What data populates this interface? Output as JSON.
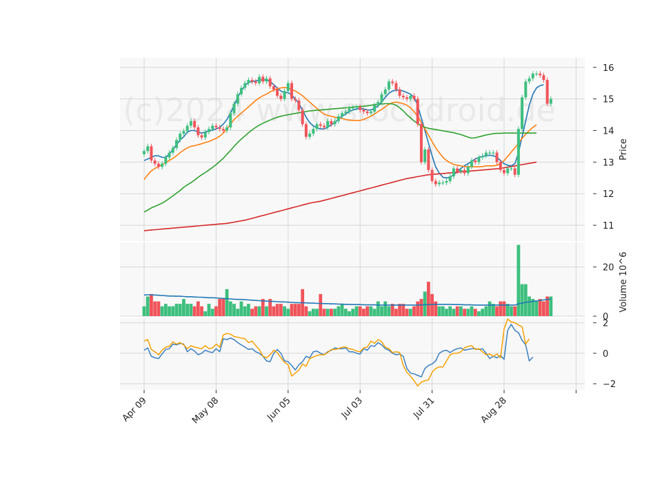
{
  "chart_data": {
    "type": "candlestick",
    "watermark": "(c)2024 www.stockdroid.de",
    "colors": {
      "up": "#3dbf7e",
      "down": "#f0545a",
      "panel_bg": "#f8f8f8",
      "grid": "#d6d6d6",
      "ma_short": "#1f77b4",
      "ma_mid": "#ff7f0e",
      "ma_long": "#2ca02c",
      "ma_longest": "#d62728",
      "volume_avg": "#1f77b4",
      "osc_1": "#3a7fbf",
      "osc_2": "#f5a000"
    },
    "x_axis": {
      "tick_labels": [
        "Apr 09",
        "May 08",
        "Jun 05",
        "Jul 03",
        "Jul 31",
        "Aug 28"
      ],
      "tick_index": [
        0,
        20,
        40,
        60,
        80,
        100
      ]
    },
    "price_panel": {
      "ylabel": "Price",
      "ylim": [
        10.5,
        16.3
      ],
      "ticks": [
        11,
        12,
        13,
        14,
        15,
        16
      ],
      "close": [
        13.35,
        13.5,
        13.05,
        12.95,
        12.85,
        12.95,
        13.15,
        13.3,
        13.45,
        13.7,
        13.9,
        13.98,
        14.15,
        14.3,
        14.1,
        13.85,
        13.78,
        13.95,
        14.05,
        14.15,
        14.1,
        14.05,
        14.0,
        14.1,
        14.55,
        14.85,
        15.15,
        15.35,
        15.5,
        15.6,
        15.55,
        15.5,
        15.7,
        15.55,
        15.65,
        15.4,
        15.3,
        15.1,
        15.0,
        15.25,
        15.5,
        15.0,
        14.95,
        14.65,
        14.2,
        13.8,
        13.9,
        14.05,
        14.2,
        14.15,
        14.1,
        14.3,
        14.2,
        14.3,
        14.45,
        14.55,
        14.6,
        14.7,
        14.72,
        14.75,
        14.65,
        14.6,
        14.55,
        14.6,
        14.8,
        14.9,
        15.15,
        15.3,
        15.55,
        15.5,
        15.3,
        15.1,
        15.05,
        15.0,
        15.1,
        15.0,
        14.2,
        13.0,
        13.4,
        12.75,
        12.4,
        12.3,
        12.35,
        12.35,
        12.4,
        12.55,
        12.8,
        12.7,
        12.75,
        12.65,
        12.85,
        13.05,
        13.0,
        13.15,
        13.2,
        13.3,
        13.3,
        13.3,
        13.0,
        12.75,
        12.65,
        12.8,
        12.8,
        12.6,
        14.05,
        15.05,
        15.55,
        15.65,
        15.8,
        15.8,
        15.75,
        15.6,
        14.85,
        15.0
      ],
      "series": [
        {
          "name": "",
          "values": [
            13.05,
            13.1,
            13.15,
            13.2,
            13.2,
            13.15,
            13.15,
            13.25,
            13.4,
            13.55,
            13.7,
            13.8,
            13.95,
            14.0,
            14.0,
            13.95,
            13.92,
            13.95,
            13.98,
            14.02,
            14.05,
            14.1,
            14.2,
            14.35,
            14.55,
            14.8,
            15.05,
            15.25,
            15.42,
            15.52,
            15.55,
            15.57,
            15.6,
            15.6,
            15.6,
            15.55,
            15.45,
            15.35,
            15.25,
            15.2,
            15.2,
            15.12,
            15.0,
            14.85,
            14.65,
            14.42,
            14.25,
            14.15,
            14.08,
            14.05,
            14.05,
            14.1,
            14.18,
            14.25,
            14.35,
            14.45,
            14.52,
            14.6,
            14.65,
            14.68,
            14.7,
            14.68,
            14.65,
            14.65,
            14.7,
            14.78,
            14.9,
            15.05,
            15.18,
            15.25,
            15.28,
            15.28,
            15.25,
            15.2,
            15.15,
            15.05,
            14.8,
            14.4,
            14.0,
            13.6,
            13.2,
            12.85,
            12.65,
            12.52,
            12.5,
            12.52,
            12.6,
            12.7,
            12.8,
            12.88,
            12.95,
            13.02,
            13.1,
            13.15,
            13.18,
            13.2,
            13.22,
            13.2,
            13.15,
            13.05,
            12.95,
            12.9,
            12.88,
            12.95,
            13.3,
            13.8,
            14.3,
            14.8,
            15.15,
            15.35,
            15.42,
            15.45
          ]
        },
        {
          "name": "",
          "values": [
            12.45,
            12.6,
            12.72,
            12.8,
            12.86,
            12.92,
            12.98,
            13.05,
            13.12,
            13.2,
            13.3,
            13.38,
            13.45,
            13.5,
            13.52,
            13.55,
            13.58,
            13.62,
            13.65,
            13.7,
            13.75,
            13.82,
            13.92,
            14.05,
            14.2,
            14.35,
            14.45,
            14.55,
            14.65,
            14.75,
            14.85,
            14.95,
            15.03,
            15.1,
            15.15,
            15.22,
            15.28,
            15.32,
            15.35,
            15.36,
            15.35,
            15.3,
            15.25,
            15.18,
            15.1,
            15.0,
            14.9,
            14.8,
            14.7,
            14.6,
            14.52,
            14.48,
            14.45,
            14.42,
            14.4,
            14.38,
            14.35,
            14.33,
            14.32,
            14.32,
            14.32,
            14.35,
            14.4,
            14.45,
            14.52,
            14.6,
            14.67,
            14.75,
            14.83,
            14.88,
            14.9,
            14.88,
            14.85,
            14.8,
            14.72,
            14.6,
            14.45,
            14.25,
            14.05,
            13.85,
            13.65,
            13.45,
            13.3,
            13.15,
            13.05,
            12.98,
            12.93,
            12.9,
            12.88,
            12.86,
            12.85,
            12.85,
            12.85,
            12.85,
            12.86,
            12.88,
            12.88,
            12.88,
            12.9,
            12.95,
            13.05,
            13.18,
            13.32,
            13.45,
            13.6,
            13.75,
            13.88,
            14.0,
            14.1,
            14.18
          ]
        },
        {
          "name": "",
          "values": [
            11.42,
            11.48,
            11.55,
            11.6,
            11.65,
            11.7,
            11.77,
            11.85,
            11.93,
            12.02,
            12.1,
            12.2,
            12.28,
            12.35,
            12.43,
            12.52,
            12.6,
            12.67,
            12.75,
            12.83,
            12.92,
            13.02,
            13.12,
            13.25,
            13.37,
            13.5,
            13.62,
            13.73,
            13.83,
            13.93,
            14.02,
            14.1,
            14.17,
            14.23,
            14.28,
            14.33,
            14.38,
            14.42,
            14.45,
            14.48,
            14.5,
            14.52,
            14.54,
            14.56,
            14.58,
            14.6,
            14.62,
            14.63,
            14.64,
            14.65,
            14.66,
            14.67,
            14.68,
            14.69,
            14.7,
            14.71,
            14.72,
            14.73,
            14.74,
            14.75,
            14.76,
            14.77,
            14.78,
            14.8,
            14.82,
            14.83,
            14.84,
            14.85,
            14.85,
            14.84,
            14.8,
            14.72,
            14.62,
            14.5,
            14.4,
            14.3,
            14.22,
            14.15,
            14.1,
            14.07,
            14.05,
            14.03,
            14.01,
            13.99,
            13.97,
            13.95,
            13.93,
            13.9,
            13.87,
            13.83,
            13.79,
            13.76,
            13.77,
            13.8,
            13.83,
            13.86,
            13.88,
            13.9,
            13.91,
            13.91,
            13.92,
            13.92,
            13.92,
            13.92,
            13.92,
            13.92,
            13.92,
            13.92,
            13.92,
            13.92
          ]
        },
        {
          "name": "",
          "values": [
            10.83,
            10.84,
            10.85,
            10.86,
            10.87,
            10.88,
            10.89,
            10.9,
            10.91,
            10.92,
            10.93,
            10.94,
            10.95,
            10.96,
            10.97,
            10.98,
            10.99,
            11.0,
            11.01,
            11.02,
            11.03,
            11.04,
            11.05,
            11.06,
            11.08,
            11.1,
            11.12,
            11.14,
            11.16,
            11.19,
            11.22,
            11.25,
            11.28,
            11.31,
            11.34,
            11.37,
            11.4,
            11.43,
            11.46,
            11.49,
            11.52,
            11.55,
            11.58,
            11.61,
            11.64,
            11.67,
            11.7,
            11.72,
            11.74,
            11.76,
            11.79,
            11.82,
            11.85,
            11.88,
            11.91,
            11.94,
            11.97,
            12.0,
            12.03,
            12.06,
            12.09,
            12.12,
            12.15,
            12.18,
            12.21,
            12.24,
            12.27,
            12.3,
            12.33,
            12.36,
            12.39,
            12.42,
            12.45,
            12.48,
            12.5,
            12.52,
            12.54,
            12.56,
            12.58,
            12.6,
            12.61,
            12.62,
            12.63,
            12.64,
            12.65,
            12.66,
            12.67,
            12.68,
            12.69,
            12.7,
            12.71,
            12.72,
            12.73,
            12.74,
            12.75,
            12.76,
            12.77,
            12.78,
            12.79,
            12.8,
            12.82,
            12.84,
            12.86,
            12.88,
            12.9,
            12.92,
            12.94,
            12.96,
            12.98,
            13.0
          ]
        }
      ]
    },
    "volume_panel": {
      "ylabel": "Volume  10^6",
      "ylim": [
        0,
        30
      ],
      "ticks": [
        0,
        20
      ],
      "values": [
        4,
        8,
        9,
        6,
        6,
        4,
        5,
        4,
        4,
        5,
        5,
        7,
        5,
        5,
        4,
        6,
        4,
        2,
        5,
        3,
        4,
        7,
        7,
        11,
        6,
        5,
        3,
        6,
        4,
        5,
        3,
        4,
        4,
        7,
        4,
        7,
        4,
        5,
        5,
        4,
        3,
        5,
        5,
        5,
        11,
        4,
        2,
        3,
        3,
        9,
        3,
        3,
        3,
        3,
        4,
        5,
        3,
        2,
        3,
        4,
        4,
        3,
        4,
        4,
        3,
        6,
        4,
        6,
        4,
        5,
        3,
        5,
        5,
        3,
        3,
        4,
        6,
        7,
        10,
        14,
        9,
        6,
        4,
        4,
        3,
        4,
        3,
        4,
        4,
        3,
        3,
        4,
        3,
        2,
        3,
        4,
        6,
        5,
        4,
        6,
        6,
        5,
        4,
        4,
        29,
        13,
        13,
        8,
        7,
        6,
        7,
        6,
        8,
        8
      ],
      "avg": [
        8.6,
        8.7,
        8.7,
        8.6,
        8.5,
        8.4,
        8.3,
        8.2,
        8.2,
        8.1,
        8.1,
        8.0,
        7.9,
        7.9,
        7.8,
        7.7,
        7.7,
        7.6,
        7.5,
        7.5,
        7.4,
        7.3,
        7.2,
        7.1,
        7.0,
        6.9,
        6.8,
        6.8,
        6.7,
        6.6,
        6.5,
        6.4,
        6.3,
        6.2,
        6.1,
        6.0,
        6.0,
        5.9,
        5.8,
        5.8,
        5.7,
        5.6,
        5.5,
        5.5,
        5.4,
        5.4,
        5.3,
        5.3,
        5.2,
        5.2,
        5.1,
        5.1,
        5.0,
        5.0,
        4.9,
        4.9,
        4.8,
        4.8,
        4.7,
        4.7,
        4.7,
        4.6,
        4.6,
        4.6,
        4.6,
        4.5,
        4.5,
        4.5,
        4.5,
        4.5,
        4.5,
        4.5,
        4.5,
        4.5,
        4.5,
        4.5,
        4.5,
        4.6,
        4.6,
        4.7,
        4.8,
        4.8,
        4.8,
        4.8,
        4.8,
        4.8,
        4.7,
        4.7,
        4.7,
        4.6,
        4.6,
        4.6,
        4.5,
        4.5,
        4.5,
        4.5,
        4.5,
        4.5,
        4.5,
        4.5,
        4.5,
        4.5,
        4.5,
        4.5,
        5.0,
        5.3,
        5.6,
        5.8,
        6.0,
        6.2,
        6.4,
        6.6,
        6.8,
        7.0
      ]
    },
    "oscillator_panel": {
      "ylim": [
        -2.4,
        2.3
      ],
      "ticks": [
        -2,
        0,
        2
      ],
      "series": [
        {
          "name": "",
          "values": [
            0.2,
            0.35,
            -0.2,
            -0.3,
            -0.35,
            -0.05,
            0.25,
            0.3,
            0.6,
            0.55,
            0.65,
            0.6,
            0.1,
            0.3,
            0.15,
            -0.1,
            0.0,
            0.2,
            0.1,
            0.05,
            0.3,
            0.1,
            0.95,
            0.9,
            1.0,
            0.9,
            0.7,
            0.55,
            0.4,
            0.25,
            0.3,
            0.1,
            0.0,
            -0.2,
            -0.5,
            -0.55,
            0.0,
            0.25,
            0.0,
            -0.5,
            -0.55,
            -0.8,
            -1.1,
            -0.75,
            -0.55,
            -0.2,
            -0.3,
            0.1,
            0.15,
            0.0,
            -0.1,
            0.1,
            0.2,
            0.35,
            0.3,
            0.3,
            0.35,
            0.1,
            0.1,
            0.0,
            -0.05,
            0.3,
            0.2,
            0.5,
            0.45,
            0.7,
            0.55,
            0.3,
            0.2,
            0.0,
            -0.1,
            -0.05,
            -0.2,
            -1.0,
            -1.3,
            -1.35,
            -1.45,
            -1.55,
            -1.0,
            -0.8,
            -0.7,
            -0.5,
            0.0,
            0.15,
            0.2,
            0.05,
            0.2,
            0.3,
            0.35,
            0.2,
            0.25,
            0.3,
            0.3,
            0.25,
            0.3,
            0.0,
            -0.35,
            -0.2,
            -0.3,
            -0.15,
            -0.4,
            1.5,
            1.9,
            1.5,
            1.35,
            0.85,
            0.55,
            -0.5,
            -0.25
          ]
        },
        {
          "name": "",
          "values": [
            0.8,
            0.9,
            0.25,
            0.1,
            -0.1,
            0.2,
            0.4,
            0.45,
            0.75,
            0.6,
            0.7,
            0.55,
            0.3,
            0.5,
            0.4,
            0.35,
            0.3,
            0.5,
            0.3,
            0.35,
            0.6,
            0.4,
            1.2,
            1.3,
            1.25,
            1.1,
            1.05,
            1.0,
            0.95,
            0.7,
            0.8,
            0.5,
            0.25,
            -0.2,
            -0.3,
            -0.1,
            0.2,
            0.05,
            -0.3,
            -0.6,
            -0.75,
            -1.5,
            -1.3,
            -1.1,
            -0.7,
            -0.85,
            -0.35,
            -0.25,
            -0.15,
            -0.1,
            -0.1,
            0.05,
            0.25,
            0.25,
            0.3,
            0.4,
            0.4,
            0.3,
            0.25,
            0.15,
            0.1,
            0.35,
            0.4,
            0.8,
            0.65,
            0.9,
            0.75,
            0.4,
            0.3,
            0.05,
            0.1,
            0.05,
            -0.8,
            -1.25,
            -1.5,
            -1.8,
            -2.15,
            -1.9,
            -1.8,
            -1.75,
            -1.25,
            -1.0,
            -0.9,
            -0.9,
            -0.5,
            -0.1,
            0.0,
            0.0,
            0.1,
            0.35,
            0.45,
            0.5,
            0.25,
            0.3,
            0.1,
            -0.1,
            -0.05,
            -0.2,
            -0.05,
            -0.3,
            1.6,
            2.25,
            2.05,
            2.0,
            1.85,
            1.75,
            0.6,
            0.95
          ]
        }
      ]
    }
  }
}
